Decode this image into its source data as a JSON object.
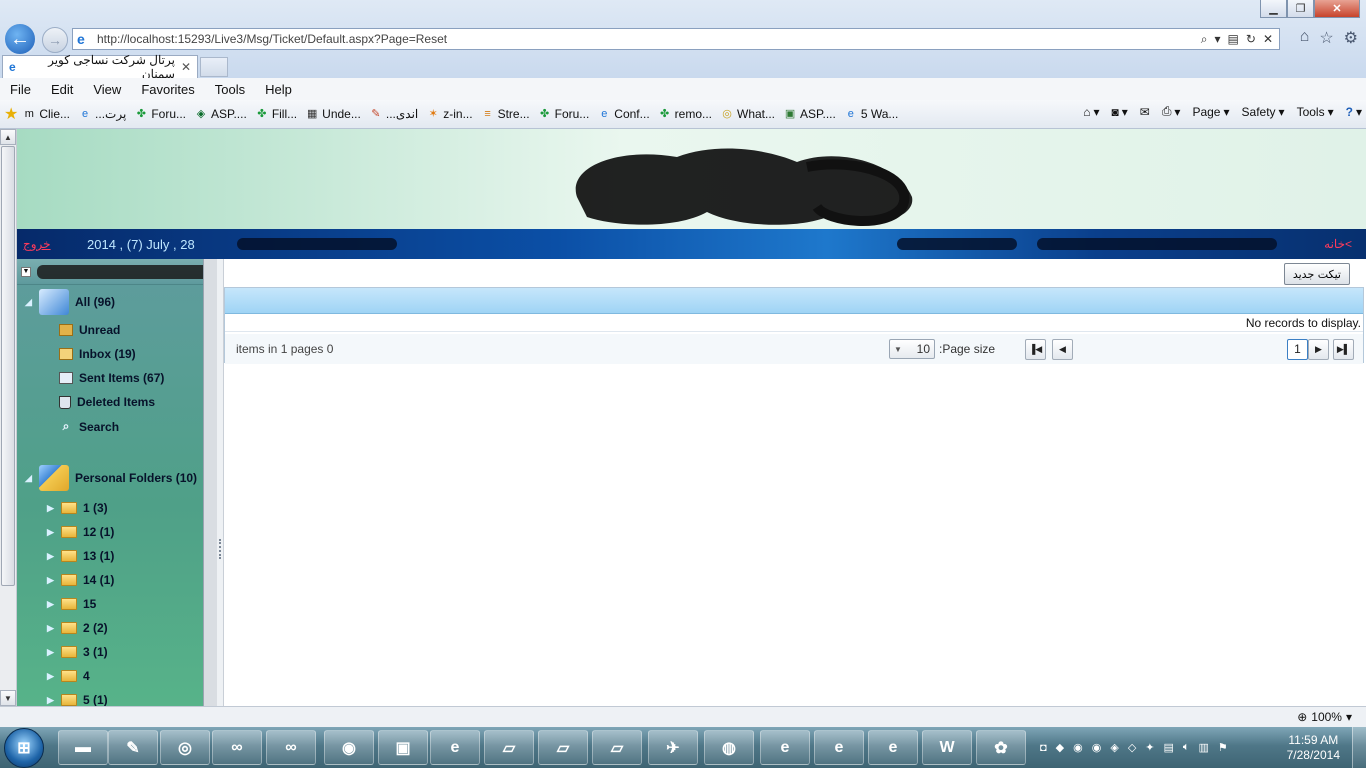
{
  "browser": {
    "url": "http://localhost:15293/Live3/Msg/Ticket/Default.aspx?Page=Reset",
    "tab_title": "پرتال شرکت نساجی کویر سمنان",
    "menu": [
      "File",
      "Edit",
      "View",
      "Favorites",
      "Tools",
      "Help"
    ],
    "favorites": [
      {
        "label": "Clie...",
        "icon": "m-icon"
      },
      {
        "label": "...پرت",
        "icon": "ie-page-icon"
      },
      {
        "label": "Foru...",
        "icon": "xamarin-icon"
      },
      {
        "label": "ASP....",
        "icon": "asp-icon"
      },
      {
        "label": "Fill...",
        "icon": "xamarin-icon"
      },
      {
        "label": "Unde...",
        "icon": "film-icon"
      },
      {
        "label": "...اندی",
        "icon": "paint-icon"
      },
      {
        "label": "z-in...",
        "icon": "star-icon"
      },
      {
        "label": "Stre...",
        "icon": "stack-icon"
      },
      {
        "label": "Foru...",
        "icon": "xamarin-icon"
      },
      {
        "label": "Conf...",
        "icon": "ie-page-icon"
      },
      {
        "label": "remo...",
        "icon": "xamarin-icon"
      },
      {
        "label": "What...",
        "icon": "disc-icon"
      },
      {
        "label": "ASP....",
        "icon": "image-icon"
      },
      {
        "label": "5 Wa...",
        "icon": "ie-page-icon"
      }
    ],
    "command_bar": [
      "Page",
      "Safety",
      "Tools"
    ],
    "zoom": "100%"
  },
  "header": {
    "logout_label": "خروج",
    "date": "2014 , (7) July , 28",
    "home_label": ">خانه"
  },
  "sidebar": {
    "all": "All (96)",
    "items": [
      {
        "label": "Unread"
      },
      {
        "label": "Inbox (19)"
      },
      {
        "label": "Sent Items (67)"
      },
      {
        "label": "Deleted Items"
      },
      {
        "label": "Search"
      }
    ],
    "personal_folders": "Personal Folders (10)",
    "folders": [
      "1 (3)",
      "12 (1)",
      "13 (1)",
      "14 (1)",
      "15",
      "2 (2)",
      "3 (1)",
      "4",
      "5 (1)"
    ]
  },
  "main": {
    "new_ticket_label": "تیکت جدید",
    "empty_text": "No records to display.",
    "pager": {
      "summary_prefix": "items in",
      "pages_count": "1",
      "summary_suffix": "pages",
      "items_count": "0",
      "page_size_label": ":Page size",
      "page_size_value": "10",
      "current_page": "1"
    }
  },
  "taskbar": {
    "clock_time": "11:59 AM",
    "clock_date": "7/28/2014"
  }
}
